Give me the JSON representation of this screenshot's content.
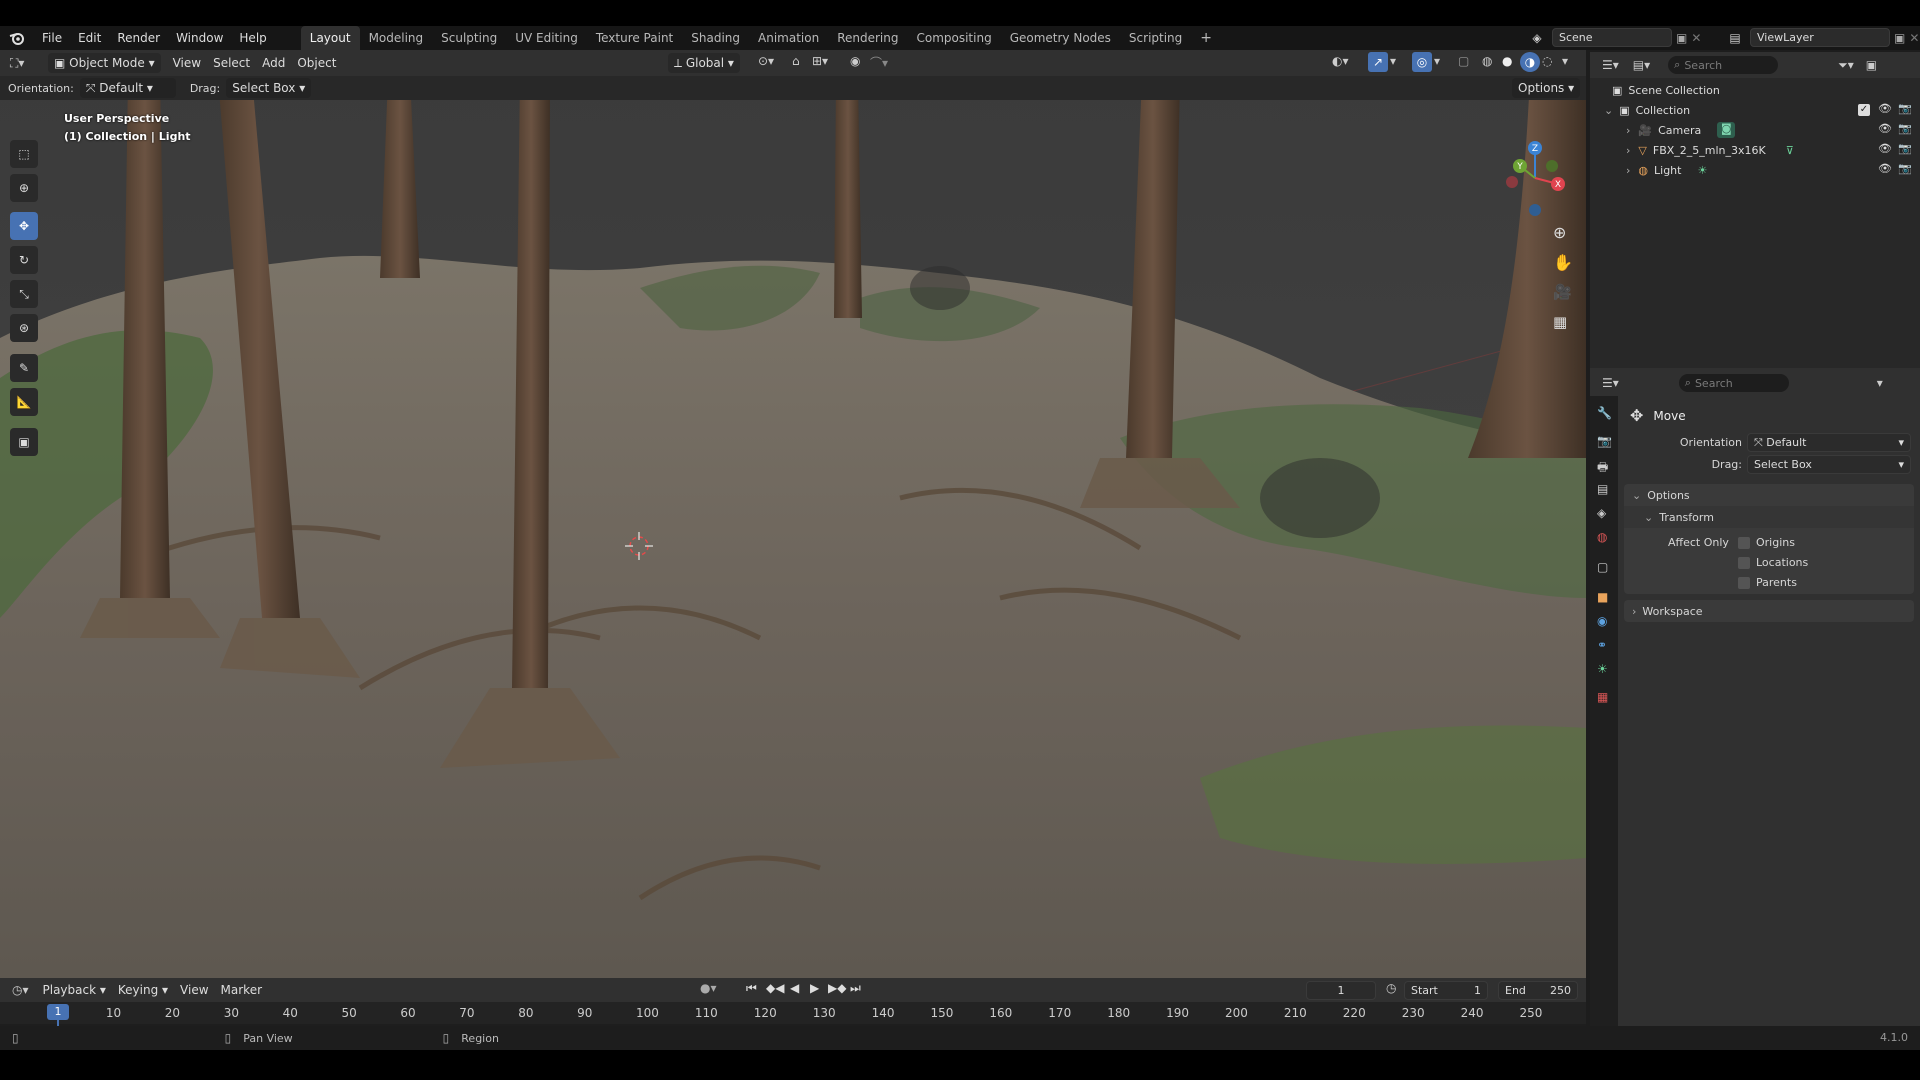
{
  "menubar": {
    "menus": [
      "File",
      "Edit",
      "Render",
      "Window",
      "Help"
    ],
    "workspaces": [
      "Layout",
      "Modeling",
      "Sculpting",
      "UV Editing",
      "Texture Paint",
      "Shading",
      "Animation",
      "Rendering",
      "Compositing",
      "Geometry Nodes",
      "Scripting"
    ],
    "active_workspace": "Layout",
    "add_tab": "+",
    "scene_label": "Scene",
    "viewlayer_label": "ViewLayer"
  },
  "viewport_header": {
    "mode": "Object Mode",
    "menus": [
      "View",
      "Select",
      "Add",
      "Object"
    ],
    "transform_orientation": "Global",
    "options_label": "Options"
  },
  "tool_settings": {
    "orientation_label": "Orientation:",
    "orientation_value": "Default",
    "drag_label": "Drag:",
    "drag_value": "Select Box"
  },
  "viewport": {
    "view_name": "User Perspective",
    "collection_info": "(1) Collection | Light",
    "gizmo_labels": {
      "z": "Z",
      "y": "Y",
      "x": "X"
    }
  },
  "outliner": {
    "search_placeholder": "Search",
    "scene_collection": "Scene Collection",
    "collection": "Collection",
    "items": [
      "Camera",
      "FBX_2_5_mln_3x16K",
      "Light"
    ]
  },
  "properties": {
    "search_placeholder": "Search",
    "tool_name": "Move",
    "orientation_label": "Orientation",
    "orientation_value": "Default",
    "drag_label": "Drag:",
    "drag_value": "Select Box",
    "options_panel": "Options",
    "transform_panel": "Transform",
    "affect_only_label": "Affect Only",
    "checkboxes": [
      "Origins",
      "Locations",
      "Parents"
    ],
    "workspace_panel": "Workspace"
  },
  "timeline": {
    "menus": [
      "Playback",
      "Keying",
      "View",
      "Marker"
    ],
    "current_frame": "1",
    "start_label": "Start",
    "start_value": "1",
    "end_label": "End",
    "end_value": "250",
    "ruler": [
      "1",
      "10",
      "20",
      "30",
      "40",
      "50",
      "60",
      "70",
      "80",
      "90",
      "100",
      "110",
      "120",
      "130",
      "140",
      "150",
      "160",
      "170",
      "180",
      "190",
      "200",
      "210",
      "220",
      "230",
      "240",
      "250"
    ]
  },
  "statusbar": {
    "pan_view": "Pan View",
    "region": "Region",
    "version": "4.1.0"
  },
  "colors": {
    "accent_blue": "#4772b3",
    "axis_x": "#e0444f",
    "axis_y": "#6ea434",
    "axis_z": "#3b84d6",
    "playhead": "#4772b3"
  }
}
